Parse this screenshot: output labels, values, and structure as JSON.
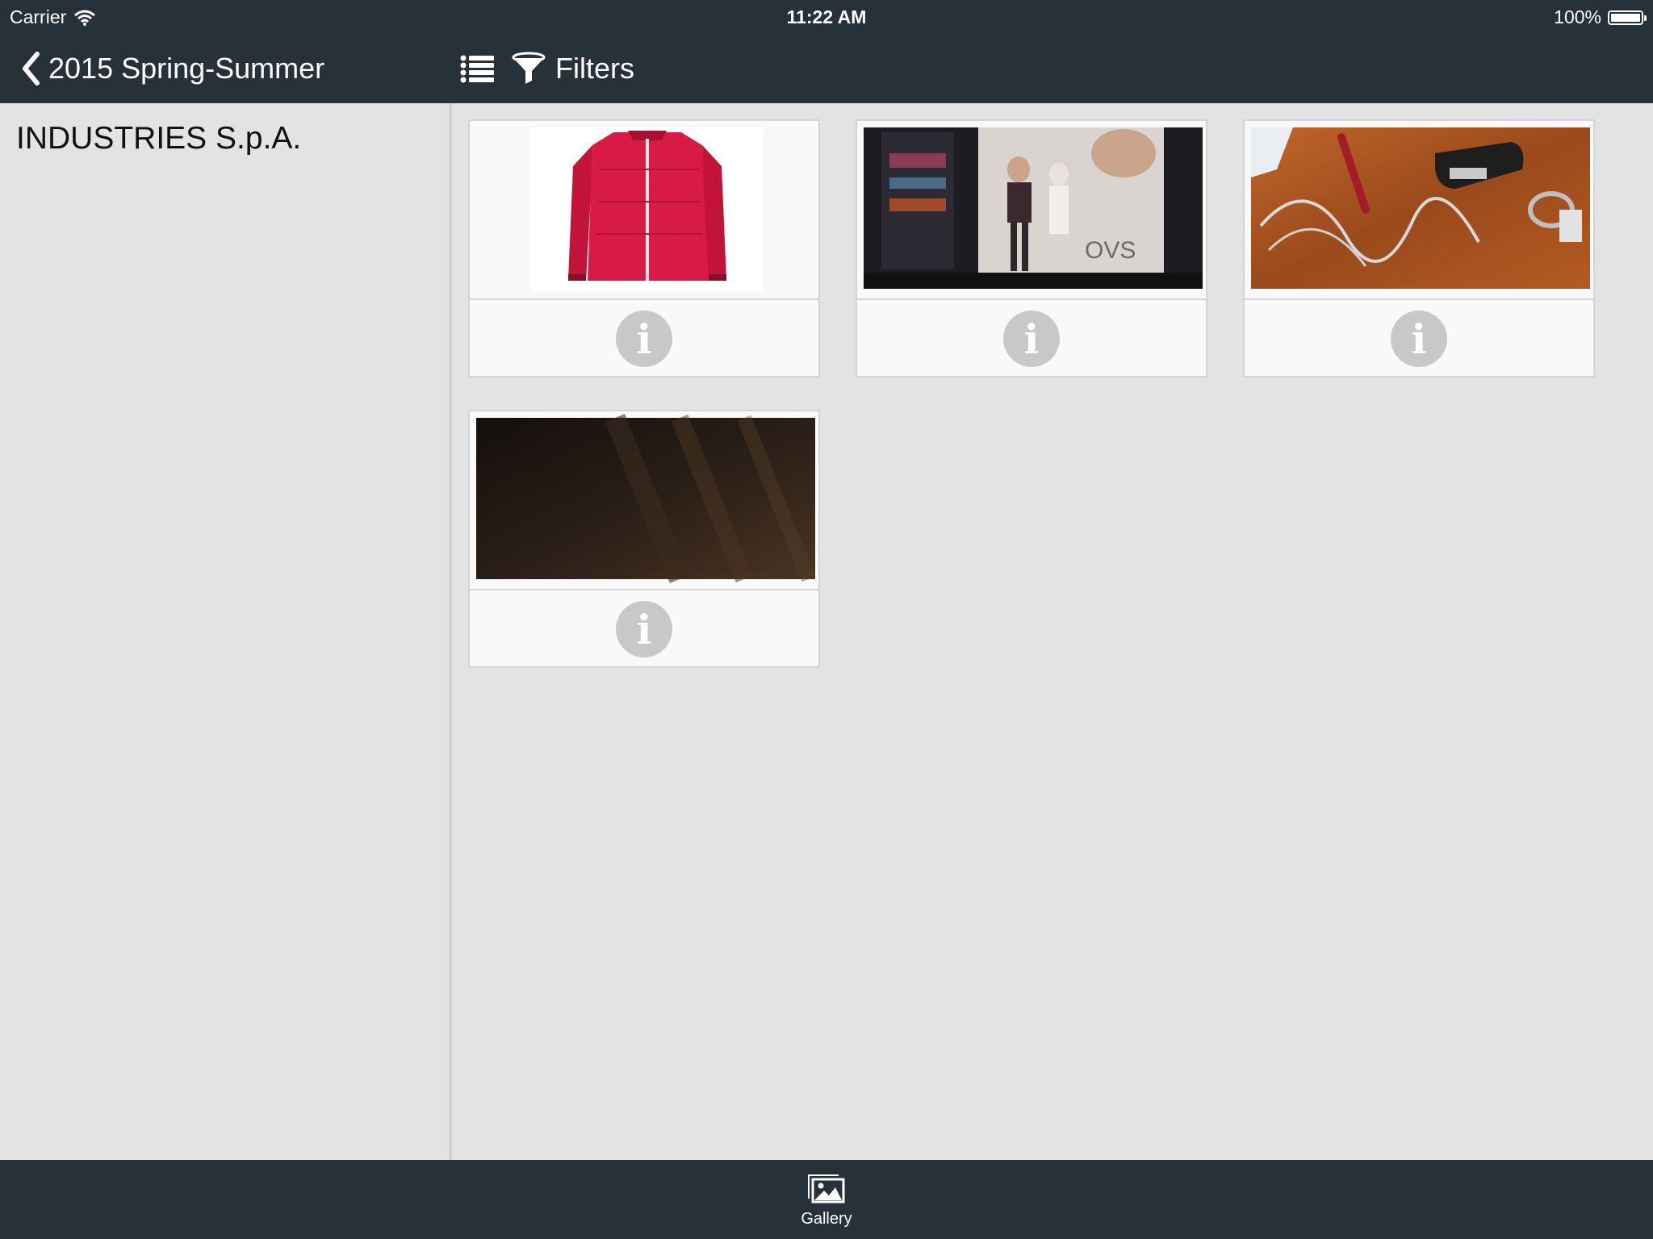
{
  "status_bar": {
    "carrier": "Carrier",
    "time": "11:22 AM",
    "battery_label": "100%",
    "battery_level": 1.0
  },
  "nav": {
    "back_label": "2015 Spring-Summer",
    "filters_label": "Filters"
  },
  "sidebar": {
    "title": "INDUSTRIES S.p.A."
  },
  "gallery": {
    "items": [
      {
        "description": "red-jacket-photo"
      },
      {
        "description": "store-window-photo"
      },
      {
        "description": "desk-items-photo"
      },
      {
        "description": "dark-brown-photo"
      }
    ],
    "store_sign_text": "OVS"
  },
  "tab_bar": {
    "gallery_label": "Gallery"
  },
  "colors": {
    "bar_background": "#27313a",
    "content_background": "#e3e3e3",
    "info_icon": "#c8c8c8"
  }
}
